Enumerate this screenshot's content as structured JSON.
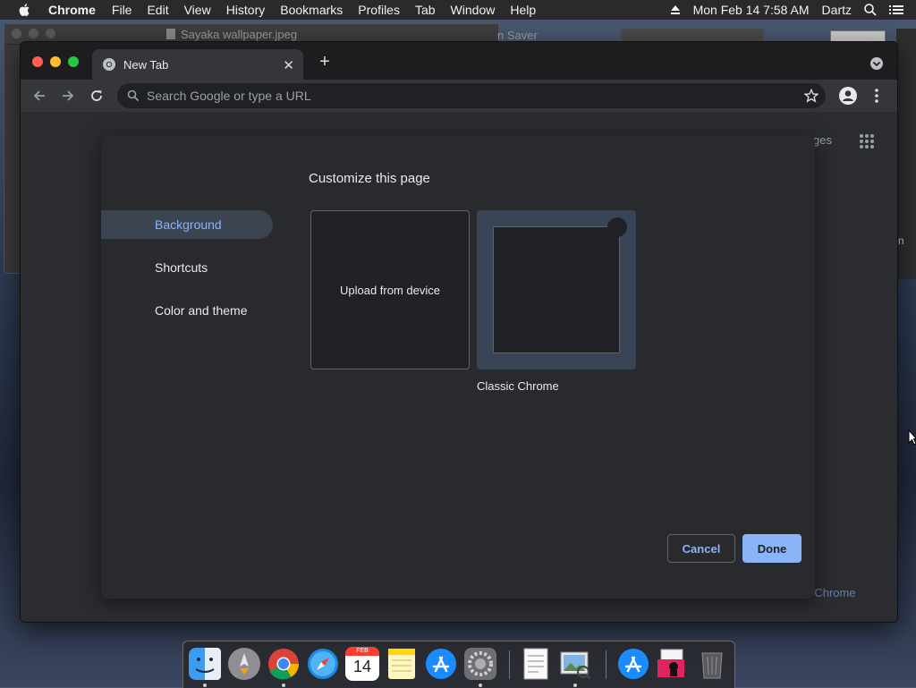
{
  "menubar": {
    "app_name": "Chrome",
    "items": [
      "File",
      "Edit",
      "View",
      "History",
      "Bookmarks",
      "Profiles",
      "Tab",
      "Window",
      "Help"
    ],
    "datetime": "Mon Feb 14  7:58 AM",
    "user": "Dartz"
  },
  "background_window": {
    "title": "Sayaka wallpaper.jpeg",
    "secondary_title": "n Saver",
    "right_partial": "n"
  },
  "chrome": {
    "tab_title": "New Tab",
    "omnibox_placeholder": "Search Google or type a URL",
    "ntp_partial_label": "ges",
    "ntp_customize_partial": "ze Chrome"
  },
  "dialog": {
    "title": "Customize this page",
    "nav": [
      "Background",
      "Shortcuts",
      "Color and theme"
    ],
    "selected_nav": "Background",
    "upload_label": "Upload from device",
    "classic_label": "Classic Chrome",
    "cancel_label": "Cancel",
    "done_label": "Done"
  },
  "dock": {
    "icons": [
      "finder-icon",
      "launchpad-icon",
      "chrome-icon",
      "safari-icon",
      "calendar-icon",
      "notes-icon",
      "app-store-icon",
      "system-preferences-icon",
      "textedit-icon",
      "preview-icon",
      "app-store-alt-icon",
      "photo-booth-icon",
      "trash-icon"
    ],
    "calendar_month": "FEB",
    "calendar_day": "14"
  },
  "colors": {
    "accent": "#8ab4f8",
    "dialog_bg": "#292a2d",
    "selected_nav_bg": "#3c4452"
  }
}
